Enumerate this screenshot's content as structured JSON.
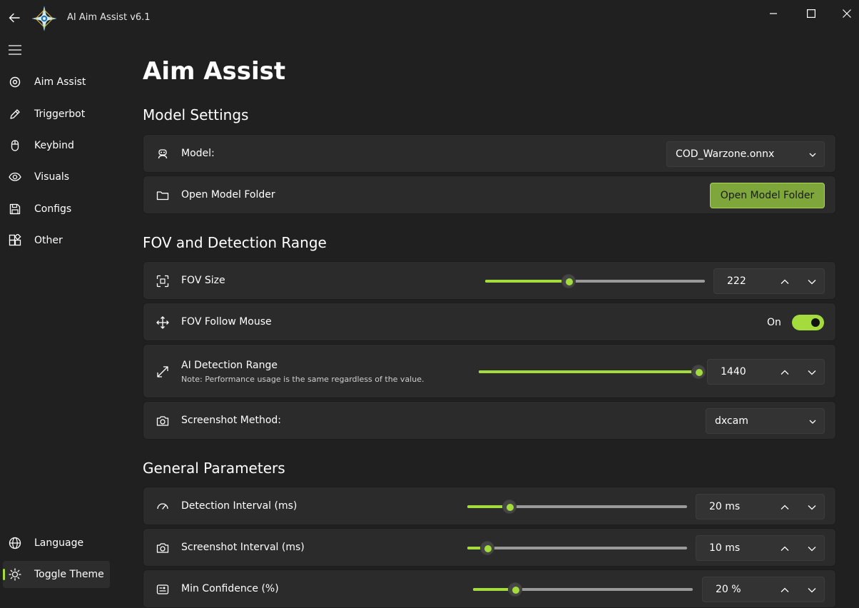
{
  "window": {
    "title": "AI Aim Assist v6.1",
    "icons": {
      "back": "back-arrow-icon",
      "logo": "compass-star-logo",
      "minimize": "minimize-icon",
      "maximize": "maximize-icon",
      "close": "close-icon"
    }
  },
  "sidebar": {
    "menu_icon": "hamburger-icon",
    "items": [
      {
        "label": "Aim Assist",
        "icon": "target-icon"
      },
      {
        "label": "Triggerbot",
        "icon": "pen-icon"
      },
      {
        "label": "Keybind",
        "icon": "mouse-icon"
      },
      {
        "label": "Visuals",
        "icon": "eye-icon"
      },
      {
        "label": "Configs",
        "icon": "save-icon"
      },
      {
        "label": "Other",
        "icon": "apps-icon"
      }
    ],
    "footer": [
      {
        "label": "Language",
        "icon": "globe-icon"
      },
      {
        "label": "Toggle Theme",
        "icon": "sun-icon",
        "active": true
      }
    ]
  },
  "page": {
    "title": "Aim Assist"
  },
  "sections": {
    "model_settings": {
      "title": "Model Settings",
      "model": {
        "label": "Model:",
        "value": "COD_Warzone.onnx"
      },
      "open_folder": {
        "label": "Open Model Folder",
        "button_label": "Open Model Folder"
      }
    },
    "fov": {
      "title": "FOV and Detection Range",
      "fov_size": {
        "label": "FOV Size",
        "value": "222",
        "slider_fraction": 0.38
      },
      "follow_mouse": {
        "label": "FOV Follow Mouse",
        "state_text": "On",
        "on": true
      },
      "detection_range": {
        "label": "AI Detection Range",
        "note": "Note: Performance usage is the same regardless of the value.",
        "value": "1440",
        "slider_fraction": 1.0
      },
      "screenshot_method": {
        "label": "Screenshot Method:",
        "value": "dxcam"
      }
    },
    "general": {
      "title": "General Parameters",
      "detection_interval": {
        "label": "Detection Interval (ms)",
        "value": "20 ms",
        "slider_fraction": 0.19
      },
      "screenshot_interval": {
        "label": "Screenshot Interval (ms)",
        "value": "10 ms",
        "slider_fraction": 0.09
      },
      "min_confidence": {
        "label": "Min Confidence (%)",
        "value": "20 %",
        "slider_fraction": 0.19
      }
    }
  },
  "colors": {
    "accent": "#a3dc3c",
    "background": "#202020",
    "card": "#2b2b2b",
    "button": "#7ea63a"
  }
}
